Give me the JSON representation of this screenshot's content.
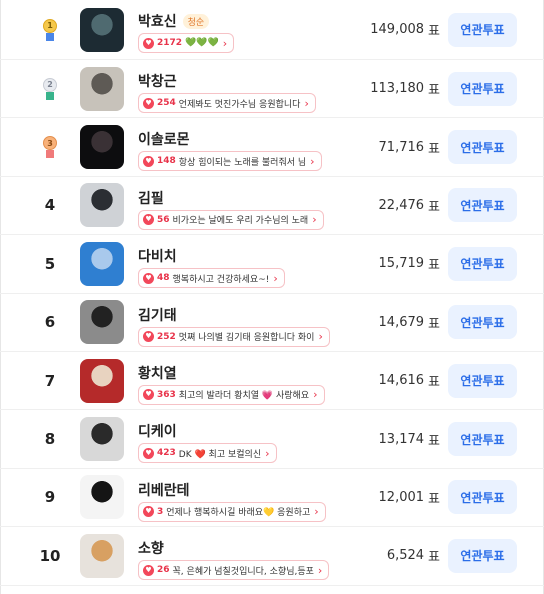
{
  "button_label": "연관투표",
  "vote_suffix": "표",
  "rows": [
    {
      "rank": "1",
      "medal": "gold",
      "name": "박효신",
      "badge": "청순",
      "count": "2172",
      "message": "💚💚💚",
      "votes": "149,008"
    },
    {
      "rank": "2",
      "medal": "silver",
      "name": "박창근",
      "badge": "",
      "count": "254",
      "message": "언제봐도 멋진가수님 응원합니다",
      "votes": "113,180"
    },
    {
      "rank": "3",
      "medal": "bronze",
      "name": "이솔로몬",
      "badge": "",
      "count": "148",
      "message": "항상 힘이되는 노래를 불러줘서 님",
      "votes": "71,716"
    },
    {
      "rank": "4",
      "medal": "",
      "name": "김필",
      "badge": "",
      "count": "56",
      "message": "비가오는 날에도 우리 가수님의 노래",
      "votes": "22,476"
    },
    {
      "rank": "5",
      "medal": "",
      "name": "다비치",
      "badge": "",
      "count": "48",
      "message": "행복하시고 건강하세요~!",
      "votes": "15,719"
    },
    {
      "rank": "6",
      "medal": "",
      "name": "김기태",
      "badge": "",
      "count": "252",
      "message": "멋쪄 나의별 김기태 응원합니다 화이",
      "votes": "14,679"
    },
    {
      "rank": "7",
      "medal": "",
      "name": "황치열",
      "badge": "",
      "count": "363",
      "message": "최고의 발라더 황치열 💗 사랑해요",
      "votes": "14,616"
    },
    {
      "rank": "8",
      "medal": "",
      "name": "디케이",
      "badge": "",
      "count": "423",
      "message": "DK ❤️ 최고 보컬의신",
      "votes": "13,174"
    },
    {
      "rank": "9",
      "medal": "",
      "name": "리베란테",
      "badge": "",
      "count": "3",
      "message": "언제나 행복하시길 바래요💛 응원하고",
      "votes": "12,001"
    },
    {
      "rank": "10",
      "medal": "",
      "name": "소향",
      "badge": "",
      "count": "26",
      "message": "꼭, 은혜가 넘칠것입니다, 소향님,등포",
      "votes": "6,524"
    }
  ],
  "colors": {
    "accent_blue": "#2b6de8",
    "button_bg": "#eaf2ff",
    "heart_red": "#e8334a"
  }
}
